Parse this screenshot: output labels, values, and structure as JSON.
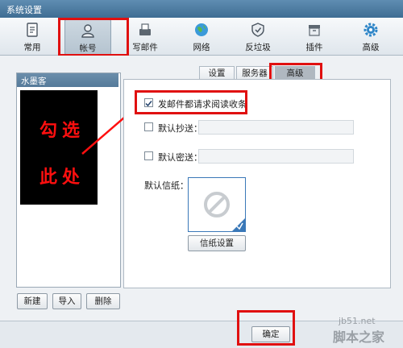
{
  "window": {
    "title": "系统设置"
  },
  "toolbar": {
    "items": [
      {
        "label": "常用",
        "icon": "document-icon"
      },
      {
        "label": "帐号",
        "icon": "user-icon"
      },
      {
        "label": "写邮件",
        "icon": "compose-icon"
      },
      {
        "label": "网络",
        "icon": "globe-icon"
      },
      {
        "label": "反垃圾",
        "icon": "shield-icon"
      },
      {
        "label": "插件",
        "icon": "plugin-icon"
      },
      {
        "label": "高级",
        "icon": "gear-icon"
      }
    ],
    "active": "帐号"
  },
  "accounts": {
    "header": "水墨客",
    "annotation_line1": "勾选",
    "annotation_line2": "此处",
    "new_label": "新建",
    "import_label": "导入",
    "delete_label": "删除"
  },
  "tabs": {
    "settings": "设置",
    "server": "服务器",
    "advanced": "高级"
  },
  "options": {
    "read_receipt": "发邮件都请求阅读收条",
    "read_receipt_checked": true,
    "cc_label": "默认抄送：",
    "cc_checked": false,
    "bcc_label": "默认密送：",
    "bcc_checked": false,
    "stationery_label": "默认信纸：",
    "stationery_button": "信纸设置"
  },
  "footer": {
    "ok_label": "确定"
  },
  "watermark": {
    "site": "jb51.net",
    "name": "脚本之家"
  },
  "colors": {
    "highlight": "#e01010",
    "titlebar": "#4a789e"
  }
}
